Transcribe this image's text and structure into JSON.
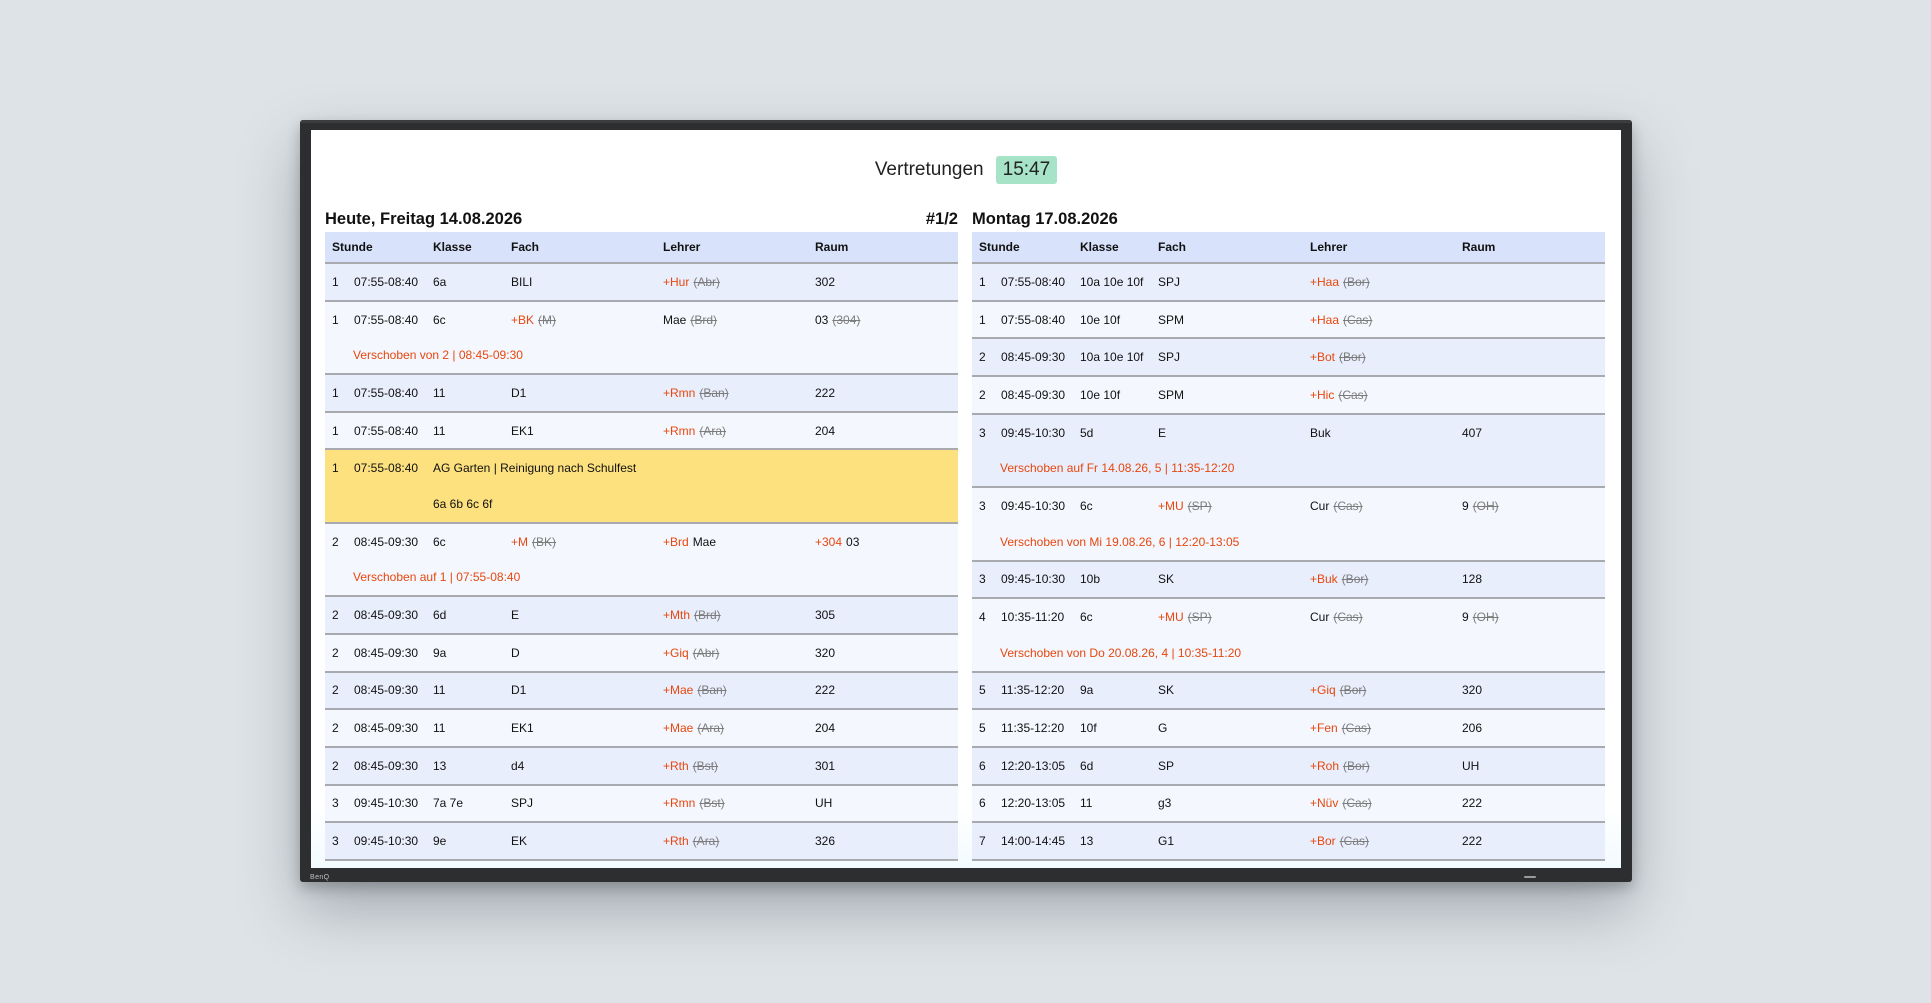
{
  "header": {
    "title": "Vertretungen",
    "clock": "15:47"
  },
  "device": {
    "brand": "BenQ"
  },
  "colors": {
    "accent_red": "#e8470e",
    "clock_bg": "#a7e3c7",
    "header_bg": "#d8e3fb",
    "highlight": "#fde17e"
  },
  "columns": {
    "stunde": "Stunde",
    "klasse": "Klasse",
    "fach": "Fach",
    "lehrer": "Lehrer",
    "raum": "Raum"
  },
  "today": {
    "title": "Heute, Freitag 14.08.2026",
    "page": "#1/2",
    "rows": [
      {
        "std": "1",
        "zeit": "07:55-08:40",
        "klasse": "6a",
        "fach": "BILI",
        "lehrer_new": "+Hur",
        "lehrer_old": "(Abr)",
        "raum": "302"
      },
      {
        "std": "1",
        "zeit": "07:55-08:40",
        "klasse": "6c",
        "fach_new": "+BK",
        "fach_old": "(M)",
        "lehrer": "Mae",
        "lehrer_old": "(Brd)",
        "raum": "03",
        "raum_old": "(304)",
        "note": "Verschoben von 2 | 08:45-09:30"
      },
      {
        "std": "1",
        "zeit": "07:55-08:40",
        "klasse": "11",
        "fach": "D1",
        "lehrer_new": "+Rmn",
        "lehrer_old": "(Ban)",
        "raum": "222"
      },
      {
        "std": "1",
        "zeit": "07:55-08:40",
        "klasse": "11",
        "fach": "EK1",
        "lehrer_new": "+Rmn",
        "lehrer_old": "(Ara)",
        "raum": "204"
      },
      {
        "std": "1",
        "zeit": "07:55-08:40",
        "text": "AG Garten | Reinigung nach Schulfest",
        "klassen": "6a 6b 6c 6f"
      },
      {
        "std": "2",
        "zeit": "08:45-09:30",
        "klasse": "6c",
        "fach_new": "+M",
        "fach_old": "(BK)",
        "lehrer_new": "+Brd",
        "lehrer": "Mae",
        "raum_new": "+304",
        "raum": "03",
        "note": "Verschoben auf 1 | 07:55-08:40"
      },
      {
        "std": "2",
        "zeit": "08:45-09:30",
        "klasse": "6d",
        "fach": "E",
        "lehrer_new": "+Mth",
        "lehrer_old": "(Brd)",
        "raum": "305"
      },
      {
        "std": "2",
        "zeit": "08:45-09:30",
        "klasse": "9a",
        "fach": "D",
        "lehrer_new": "+Giq",
        "lehrer_old": "(Abr)",
        "raum": "320"
      },
      {
        "std": "2",
        "zeit": "08:45-09:30",
        "klasse": "11",
        "fach": "D1",
        "lehrer_new": "+Mae",
        "lehrer_old": "(Ban)",
        "raum": "222"
      },
      {
        "std": "2",
        "zeit": "08:45-09:30",
        "klasse": "11",
        "fach": "EK1",
        "lehrer_new": "+Mae",
        "lehrer_old": "(Ara)",
        "raum": "204"
      },
      {
        "std": "2",
        "zeit": "08:45-09:30",
        "klasse": "13",
        "fach": "d4",
        "lehrer_new": "+Rth",
        "lehrer_old": "(Bst)",
        "raum": "301"
      },
      {
        "std": "3",
        "zeit": "09:45-10:30",
        "klasse": "7a 7e",
        "fach": "SPJ",
        "lehrer_new": "+Rmn",
        "lehrer_old": "(Bst)",
        "raum": "UH"
      },
      {
        "std": "3",
        "zeit": "09:45-10:30",
        "klasse": "9e",
        "fach": "EK",
        "lehrer_new": "+Rth",
        "lehrer_old": "(Ara)",
        "raum": "326"
      }
    ]
  },
  "monday": {
    "title": "Montag 17.08.2026",
    "rows": [
      {
        "std": "1",
        "zeit": "07:55-08:40",
        "klasse": "10a 10e 10f",
        "fach": "SPJ",
        "lehrer_new": "+Haa",
        "lehrer_old": "(Bor)"
      },
      {
        "std": "1",
        "zeit": "07:55-08:40",
        "klasse": "10e 10f",
        "fach": "SPM",
        "lehrer_new": "+Haa",
        "lehrer_old": "(Cas)"
      },
      {
        "std": "2",
        "zeit": "08:45-09:30",
        "klasse": "10a 10e 10f",
        "fach": "SPJ",
        "lehrer_new": "+Bot",
        "lehrer_old": "(Bor)"
      },
      {
        "std": "2",
        "zeit": "08:45-09:30",
        "klasse": "10e 10f",
        "fach": "SPM",
        "lehrer_new": "+Hic",
        "lehrer_old": "(Cas)"
      },
      {
        "std": "3",
        "zeit": "09:45-10:30",
        "klasse": "5d",
        "fach": "E",
        "lehrer": "Buk",
        "raum": "407",
        "note": "Verschoben auf Fr 14.08.26, 5 | 11:35-12:20"
      },
      {
        "std": "3",
        "zeit": "09:45-10:30",
        "klasse": "6c",
        "fach_new": "+MU",
        "fach_old": "(SP)",
        "lehrer": "Cur",
        "lehrer_old": "(Cas)",
        "raum": "9",
        "raum_old": "(OH)",
        "note": "Verschoben von Mi 19.08.26, 6 | 12:20-13:05"
      },
      {
        "std": "3",
        "zeit": "09:45-10:30",
        "klasse": "10b",
        "fach": "SK",
        "lehrer_new": "+Buk",
        "lehrer_old": "(Bor)",
        "raum": "128"
      },
      {
        "std": "4",
        "zeit": "10:35-11:20",
        "klasse": "6c",
        "fach_new": "+MU",
        "fach_old": "(SP)",
        "lehrer": "Cur",
        "lehrer_old": "(Cas)",
        "raum": "9",
        "raum_old": "(OH)",
        "note": "Verschoben von Do 20.08.26, 4 | 10:35-11:20"
      },
      {
        "std": "5",
        "zeit": "11:35-12:20",
        "klasse": "9a",
        "fach": "SK",
        "lehrer_new": "+Giq",
        "lehrer_old": "(Bor)",
        "raum": "320"
      },
      {
        "std": "5",
        "zeit": "11:35-12:20",
        "klasse": "10f",
        "fach": "G",
        "lehrer_new": "+Fen",
        "lehrer_old": "(Cas)",
        "raum": "206"
      },
      {
        "std": "6",
        "zeit": "12:20-13:05",
        "klasse": "6d",
        "fach": "SP",
        "lehrer_new": "+Roh",
        "lehrer_old": "(Bor)",
        "raum": "UH"
      },
      {
        "std": "6",
        "zeit": "12:20-13:05",
        "klasse": "11",
        "fach": "g3",
        "lehrer_new": "+Nüv",
        "lehrer_old": "(Cas)",
        "raum": "222"
      },
      {
        "std": "7",
        "zeit": "14:00-14:45",
        "klasse": "13",
        "fach": "G1",
        "lehrer_new": "+Bor",
        "lehrer_old": "(Cas)",
        "raum": "222"
      }
    ]
  }
}
